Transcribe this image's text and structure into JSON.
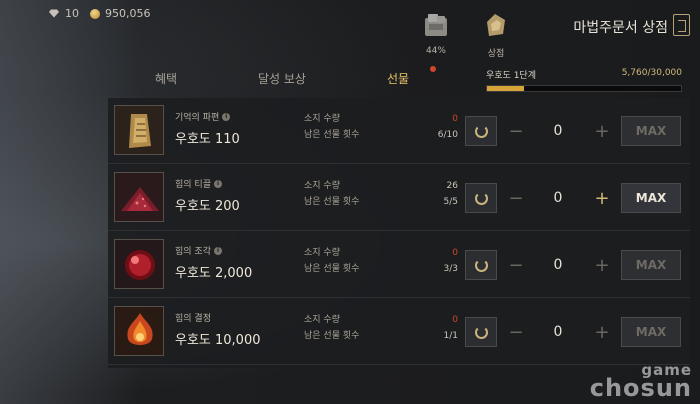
{
  "currency": {
    "gem_count": "10",
    "gold": "950,056"
  },
  "top_icons": [
    {
      "name": "scroll-box",
      "label": "44%"
    },
    {
      "name": "store-bag",
      "label": "상점"
    }
  ],
  "store_title": "마법주문서 상점",
  "tabs": [
    {
      "label": "혜택",
      "active": false
    },
    {
      "label": "달성 보상",
      "active": false
    },
    {
      "label": "선물",
      "active": true
    }
  ],
  "progress": {
    "label": "우호도 1단계",
    "value_text": "5,760/30,000",
    "current": 5760,
    "max": 30000
  },
  "labels": {
    "owned": "소지 수량",
    "remaining": "남은 선물 횟수",
    "max_button": "MAX"
  },
  "items": [
    {
      "name": "기억의 파편",
      "price": "우호도 110",
      "owned": "0",
      "owned_zero": true,
      "remaining": "6/10",
      "qty": "0",
      "plus_enabled": false,
      "max_enabled": false,
      "icon": "parchment-icon"
    },
    {
      "name": "힘의 티끌",
      "price": "우호도 200",
      "owned": "26",
      "owned_zero": false,
      "remaining": "5/5",
      "qty": "0",
      "plus_enabled": true,
      "max_enabled": true,
      "icon": "red-dust-icon"
    },
    {
      "name": "힘의 조각",
      "price": "우호도 2,000",
      "owned": "0",
      "owned_zero": true,
      "remaining": "3/3",
      "qty": "0",
      "plus_enabled": false,
      "max_enabled": false,
      "icon": "red-orb-icon"
    },
    {
      "name": "힘의 결정",
      "price": "우호도 10,000",
      "owned": "0",
      "owned_zero": true,
      "remaining": "1/1",
      "qty": "0",
      "plus_enabled": false,
      "max_enabled": false,
      "icon": "fire-crystal-icon"
    }
  ],
  "watermark": {
    "line1": "game",
    "line2": "chosun"
  }
}
